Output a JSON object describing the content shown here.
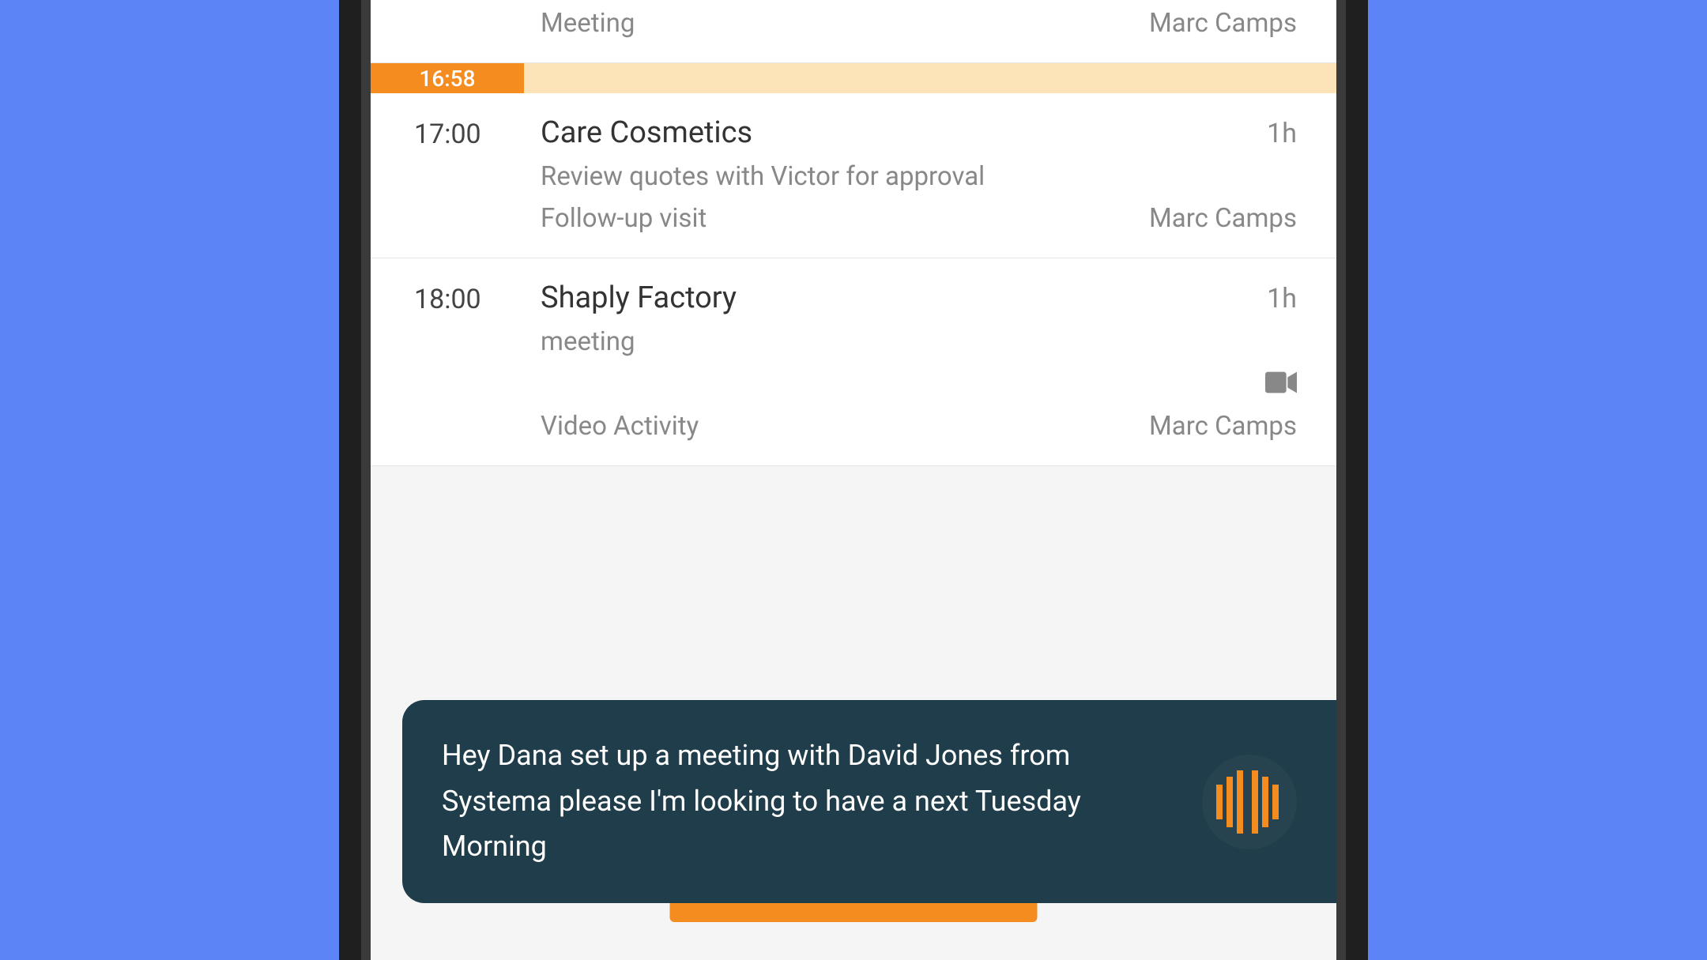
{
  "partial_event_top": {
    "type": "Meeting",
    "owner": "Marc Camps"
  },
  "time_marker": "16:58",
  "events": [
    {
      "time": "17:00",
      "title": "Care Cosmetics",
      "duration": "1h",
      "desc": "Review quotes with Victor for approval",
      "type": "Follow-up visit",
      "owner": "Marc Camps",
      "has_video": false
    },
    {
      "time": "18:00",
      "title": "Shaply Factory",
      "duration": "1h",
      "desc": "meeting",
      "type": "Video Activity",
      "owner": "Marc Camps",
      "has_video": true
    }
  ],
  "voice": {
    "transcript": "Hey Dana set up a meeting with David Jones from Systema please I'm looking to have a next Tuesday Morning"
  },
  "colors": {
    "background": "#5c84f7",
    "accent": "#f58c1f",
    "accent_light": "#fce4b8",
    "overlay_bg": "#1f3d4a"
  }
}
